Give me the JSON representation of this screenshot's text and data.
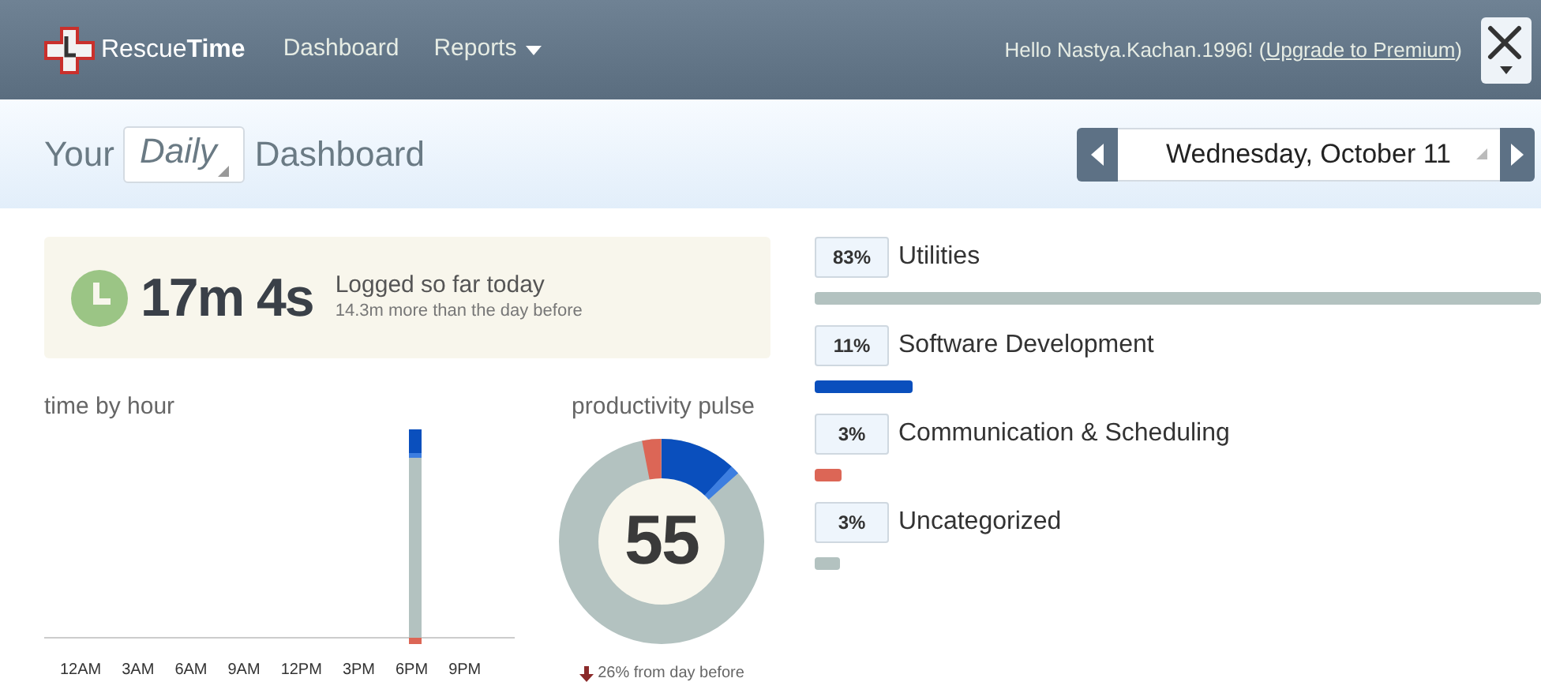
{
  "header": {
    "brand_regular": "Rescue",
    "brand_bold": "Time",
    "nav": [
      {
        "label": "Dashboard",
        "dropdown": false
      },
      {
        "label": "Reports",
        "dropdown": true
      }
    ],
    "greeting": "Hello Nastya.Kachan.1996! (",
    "upgrade_link": "Upgrade to Premium",
    "greeting_end": ")"
  },
  "subheader": {
    "title_before": "Your",
    "period": "Daily",
    "title_after": "Dashboard",
    "date": "Wednesday, October 11"
  },
  "summary": {
    "total": "17m 4s",
    "caption": "Logged so far today",
    "comparison": "14.3m more than the day before"
  },
  "time_by_hour": {
    "title": "time by hour",
    "hours": [
      "12AM",
      "3AM",
      "6AM",
      "9AM",
      "12PM",
      "3PM",
      "6PM",
      "9PM"
    ]
  },
  "productivity_pulse": {
    "title": "productivity pulse",
    "score": "55",
    "change": "26% from day before"
  },
  "categories": [
    {
      "percent": "83%",
      "name": "Utilities",
      "color": "#b3c2c0"
    },
    {
      "percent": "11%",
      "name": "Software Development",
      "color": "#0a4fbd"
    },
    {
      "percent": "3%",
      "name": "Communication & Scheduling",
      "color": "#dc6656"
    },
    {
      "percent": "3%",
      "name": "Uncategorized",
      "color": "#b3c2c0"
    }
  ]
}
